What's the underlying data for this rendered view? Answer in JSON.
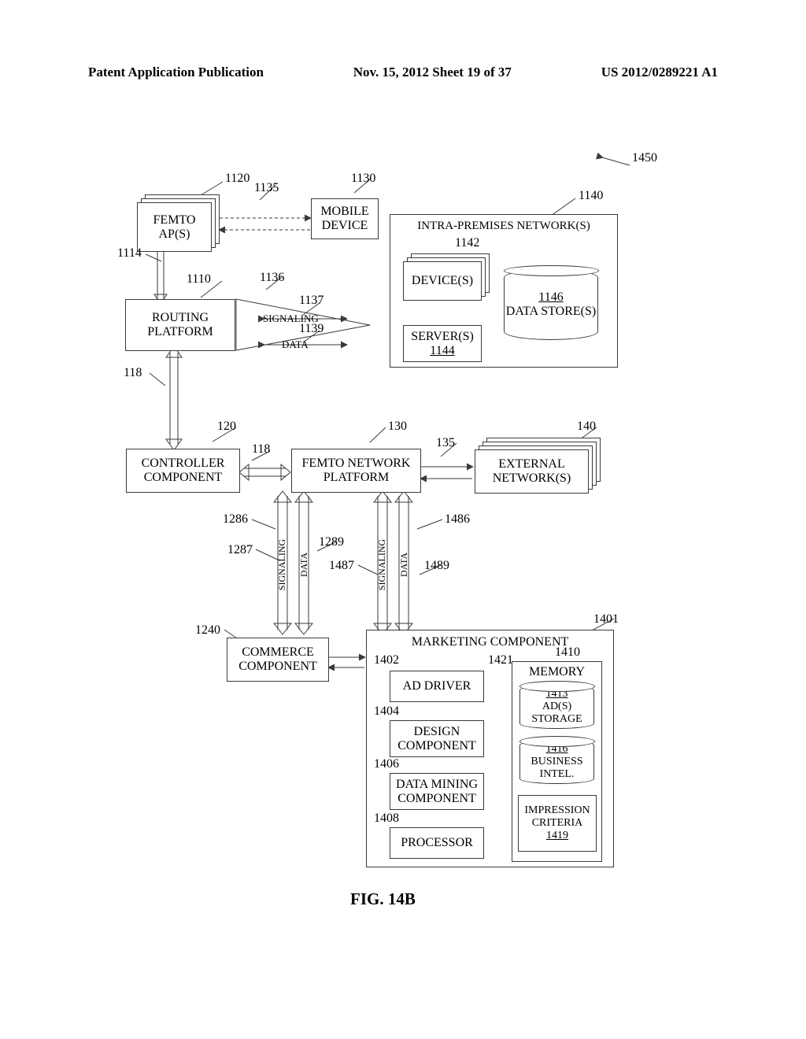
{
  "header": {
    "left": "Patent Application Publication",
    "middle": "Nov. 15, 2012  Sheet 19 of 37",
    "right": "US 2012/0289221 A1"
  },
  "refs": {
    "r1450": "1450",
    "r1120": "1120",
    "r1135": "1135",
    "r1130": "1130",
    "r1140": "1140",
    "r1142": "1142",
    "r1146": "1146",
    "r1114": "1114",
    "r1110": "1110",
    "r1136": "1136",
    "r1137": "1137",
    "r1139": "1139",
    "r118a": "118",
    "r120": "120",
    "r118b": "118",
    "r130": "130",
    "r135": "135",
    "r140": "140",
    "r1286": "1286",
    "r1287": "1287",
    "r1289": "1289",
    "r1486": "1486",
    "r1487": "1487",
    "r1489": "1489",
    "r1240": "1240",
    "r1401": "1401",
    "r1402": "1402",
    "r1404": "1404",
    "r1406": "1406",
    "r1408": "1408",
    "r1410": "1410",
    "r1413": "1413",
    "r1416": "1416",
    "r1419": "1419",
    "r1421": "1421",
    "r1144": "1144"
  },
  "boxes": {
    "femto_ap": "FEMTO AP(S)",
    "mobile_device": "MOBILE DEVICE",
    "intra_net": "INTRA-PREMISES NETWORK(S)",
    "devices": "DEVICE(S)",
    "servers": "SERVER(S)",
    "data_store": "DATA STORE(S)",
    "routing": "ROUTING PLATFORM",
    "controller": "CONTROLLER COMPONENT",
    "femto_platform": "FEMTO NETWORK PLATFORM",
    "external": "EXTERNAL NETWORK(S)",
    "commerce": "COMMERCE COMPONENT",
    "marketing": "MARKETING COMPONENT",
    "ad_driver": "AD DRIVER",
    "design": "DESIGN COMPONENT",
    "data_mining": "DATA MINING COMPONENT",
    "processor": "PROCESSOR",
    "memory": "MEMORY",
    "ads_storage": "AD(S) STORAGE",
    "business_intel": "BUSINESS INTEL.",
    "impression": "IMPRESSION CRITERIA"
  },
  "arrows": {
    "signaling": "SIGNALING",
    "data": "DATA"
  },
  "caption": "FIG. 14B"
}
